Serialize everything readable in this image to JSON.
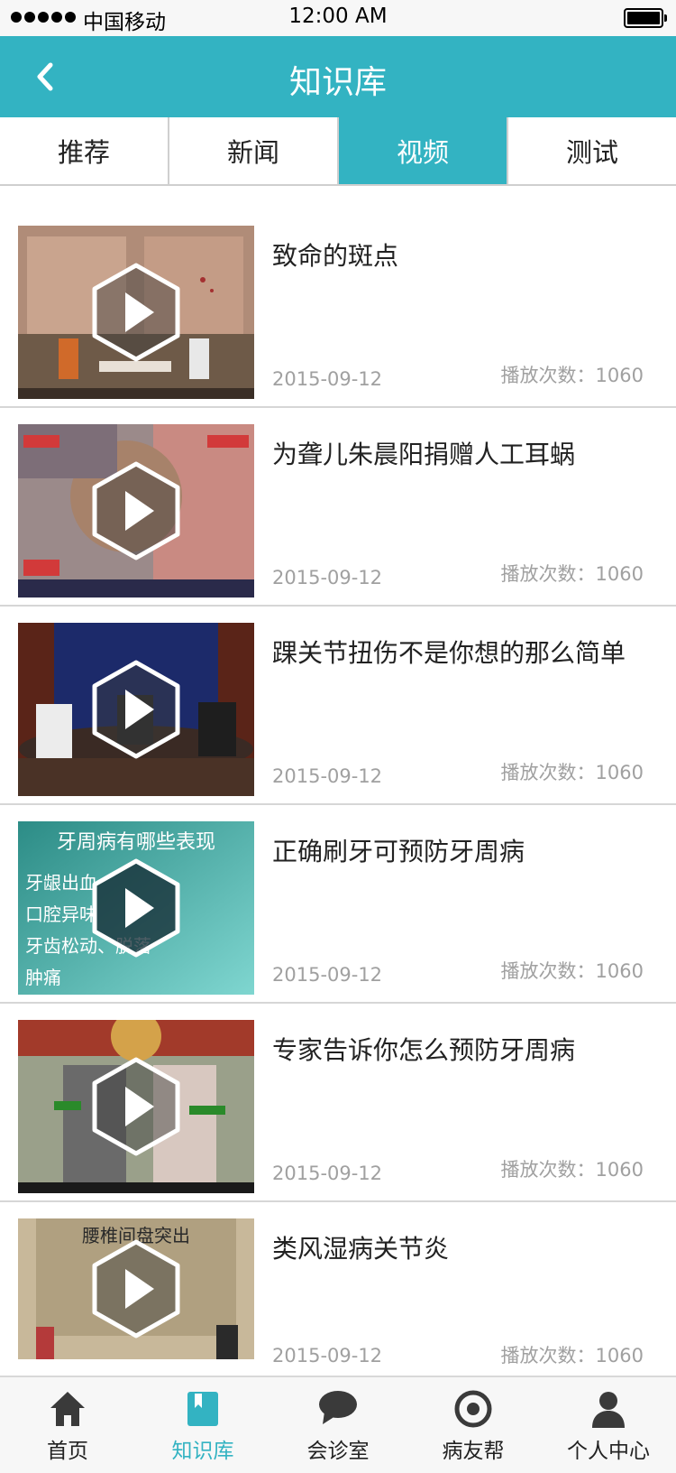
{
  "status_bar": {
    "carrier": "中国移动",
    "time": "12:00 AM"
  },
  "nav": {
    "title": "知识库"
  },
  "tabs": [
    {
      "label": "推荐",
      "active": false
    },
    {
      "label": "新闻",
      "active": false
    },
    {
      "label": "视频",
      "active": true
    },
    {
      "label": "测试",
      "active": false
    }
  ],
  "videos": [
    {
      "title": "致命的斑点",
      "date": "2015-09-12",
      "views": "播放次数：1060"
    },
    {
      "title": "为聋儿朱晨阳捐赠人工耳蜗",
      "date": "2015-09-12",
      "views": "播放次数：1060"
    },
    {
      "title": "踝关节扭伤不是你想的那么简单",
      "date": "2015-09-12",
      "views": "播放次数：1060"
    },
    {
      "title": "正确刷牙可预防牙周病",
      "date": "2015-09-12",
      "views": "播放次数：1060"
    },
    {
      "title": "专家告诉你怎么预防牙周病",
      "date": "2015-09-12",
      "views": "播放次数：1060"
    },
    {
      "title": "类风湿病关节炎",
      "date": "2015-09-12",
      "views": "播放次数：1060"
    }
  ],
  "thumb_texts": {
    "v4_line1": "牙周病有哪些表现",
    "v4_line2": "牙龈出血",
    "v4_line3": "口腔异味",
    "v4_line4": "牙齿松动、脱落",
    "v4_line5": "肿痛",
    "v6_banner": "腰椎间盘突出"
  },
  "tab_bar": [
    {
      "label": "首页",
      "icon": "home-icon",
      "active": false
    },
    {
      "label": "知识库",
      "icon": "book-icon",
      "active": true
    },
    {
      "label": "会诊室",
      "icon": "chat-bubble-icon",
      "active": false
    },
    {
      "label": "病友帮",
      "icon": "target-icon",
      "active": false
    },
    {
      "label": "个人中心",
      "icon": "person-icon",
      "active": false
    }
  ],
  "colors": {
    "accent": "#33b3c2",
    "tab_inactive": "#222222",
    "meta_text": "#a0a0a0"
  }
}
